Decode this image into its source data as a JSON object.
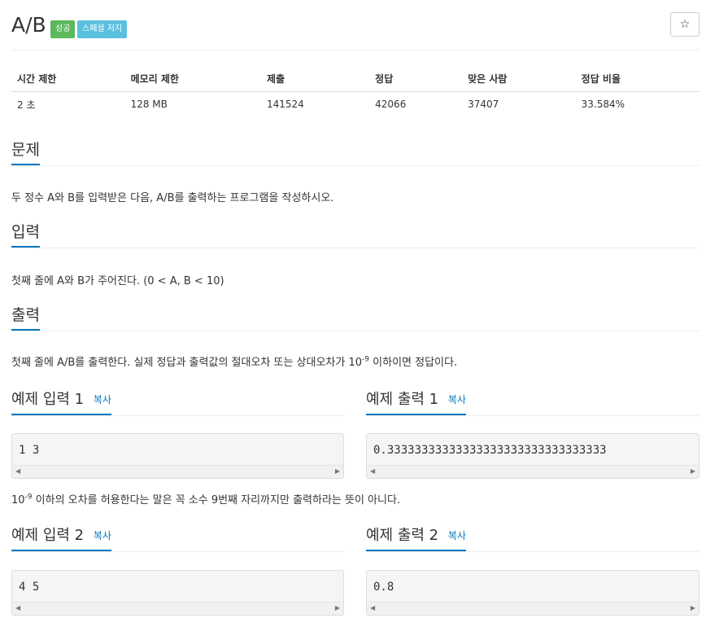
{
  "problem": {
    "title": "A/B",
    "badges": {
      "success": "성공",
      "special": "스페셜 저지"
    },
    "star_icon": "☆"
  },
  "info_table": {
    "headers": [
      "시간 제한",
      "메모리 제한",
      "제출",
      "정답",
      "맞은 사람",
      "정답 비율"
    ],
    "values": [
      "2 초",
      "128 MB",
      "141524",
      "42066",
      "37407",
      "33.584%"
    ]
  },
  "sections": {
    "description": {
      "heading": "문제",
      "text": "두 정수 A와 B를 입력받은 다음, A/B를 출력하는 프로그램을 작성하시오."
    },
    "input": {
      "heading": "입력",
      "text": "첫째 줄에 A와 B가 주어진다. (0 < A, B < 10)"
    },
    "output": {
      "heading": "출력",
      "text_before": "첫째 줄에 A/B를 출력한다. 실제 정답과 출력값의 절대오차 또는 상대오차가 10",
      "sup": "-9",
      "text_after": " 이하이면 정답이다."
    }
  },
  "examples": {
    "copy_label": "복사",
    "input1": {
      "heading": "예제 입력 1",
      "code": "1 3"
    },
    "output1": {
      "heading": "예제 출력 1",
      "code": "0.33333333333333333333333333333333"
    },
    "note": {
      "before": "10",
      "sup": "-9",
      "after": " 이하의 오차를 허용한다는 말은 꼭 소수 9번째 자리까지만 출력하라는 뜻이 아니다."
    },
    "input2": {
      "heading": "예제 입력 2",
      "code": "4 5"
    },
    "output2": {
      "heading": "예제 출력 2",
      "code": "0.8"
    }
  },
  "scroll_icons": {
    "left": "◀",
    "right": "▶"
  },
  "colors": {
    "accent": "#0076c0",
    "success": "#5cb85c",
    "special": "#5bc0de"
  }
}
